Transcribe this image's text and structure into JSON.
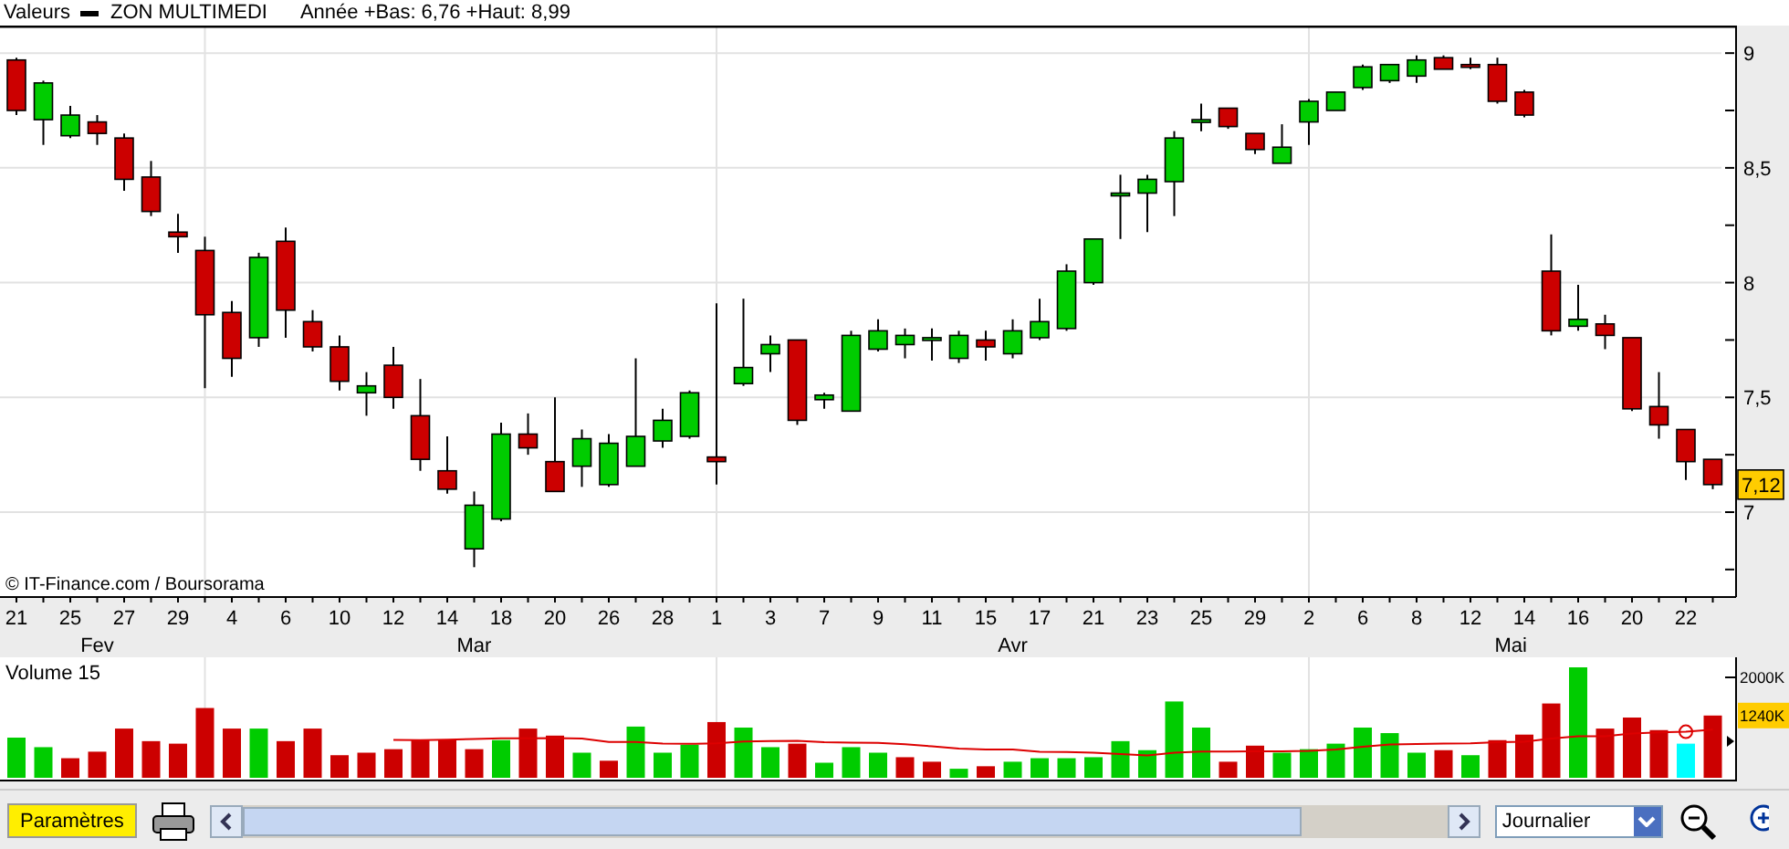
{
  "header": {
    "label": "Valeurs",
    "instrument": "ZON MULTIMEDI",
    "summary": "Année +Bas: 6,76 +Haut: 8,99"
  },
  "price_chart": {
    "source": "© IT-Finance.com / Boursorama",
    "last_price": "7,12",
    "chart_data": {
      "type": "candlestick",
      "grid": true,
      "ylim": [
        6.63,
        9.12
      ],
      "yticks": [
        {
          "value": 9,
          "label": "9"
        },
        {
          "value": 8.5,
          "label": "8,5"
        },
        {
          "value": 8,
          "label": "8"
        },
        {
          "value": 7.5,
          "label": "7,5"
        },
        {
          "value": 7,
          "label": "7"
        }
      ],
      "categories": [
        "21",
        null,
        "25",
        null,
        "27",
        null,
        "29",
        null,
        "4",
        null,
        "6",
        null,
        "10",
        null,
        "12",
        null,
        "14",
        null,
        "18",
        null,
        "20",
        null,
        "26",
        null,
        "28",
        null,
        "1",
        null,
        "3",
        null,
        "7",
        null,
        "9",
        null,
        "11",
        null,
        "15",
        null,
        "17",
        null,
        "21",
        null,
        "23",
        null,
        "25",
        null,
        "29",
        null,
        "2",
        null,
        "6",
        null,
        "8",
        null,
        "12",
        null,
        "14",
        null,
        "16",
        null,
        "20",
        null,
        "22",
        null
      ],
      "ohlc": [
        [
          8.97,
          8.98,
          8.73,
          8.75
        ],
        [
          8.71,
          8.88,
          8.6,
          8.87
        ],
        [
          8.64,
          8.77,
          8.63,
          8.73
        ],
        [
          8.7,
          8.73,
          8.6,
          8.65
        ],
        [
          8.63,
          8.65,
          8.4,
          8.45
        ],
        [
          8.46,
          8.53,
          8.29,
          8.31
        ],
        [
          8.22,
          8.3,
          8.13,
          8.2
        ],
        [
          8.14,
          8.2,
          7.54,
          7.86
        ],
        [
          7.87,
          7.92,
          7.59,
          7.67
        ],
        [
          7.76,
          8.13,
          7.72,
          8.11
        ],
        [
          8.18,
          8.24,
          7.76,
          7.88
        ],
        [
          7.83,
          7.88,
          7.7,
          7.72
        ],
        [
          7.72,
          7.77,
          7.53,
          7.57
        ],
        [
          7.52,
          7.61,
          7.42,
          7.55
        ],
        [
          7.64,
          7.72,
          7.45,
          7.5
        ],
        [
          7.42,
          7.58,
          7.18,
          7.23
        ],
        [
          7.18,
          7.33,
          7.08,
          7.1
        ],
        [
          6.84,
          7.09,
          6.76,
          7.03
        ],
        [
          6.97,
          7.39,
          6.96,
          7.34
        ],
        [
          7.34,
          7.43,
          7.25,
          7.28
        ],
        [
          7.22,
          7.5,
          7.09,
          7.09
        ],
        [
          7.2,
          7.36,
          7.11,
          7.32
        ],
        [
          7.12,
          7.34,
          7.11,
          7.3
        ],
        [
          7.2,
          7.67,
          7.2,
          7.33
        ],
        [
          7.31,
          7.45,
          7.28,
          7.4
        ],
        [
          7.33,
          7.53,
          7.32,
          7.52
        ],
        [
          7.24,
          7.91,
          7.12,
          7.22
        ],
        [
          7.56,
          7.93,
          7.55,
          7.63
        ],
        [
          7.69,
          7.77,
          7.61,
          7.73
        ],
        [
          7.75,
          7.75,
          7.38,
          7.4
        ],
        [
          7.49,
          7.52,
          7.45,
          7.51
        ],
        [
          7.44,
          7.79,
          7.44,
          7.77
        ],
        [
          7.71,
          7.84,
          7.7,
          7.79
        ],
        [
          7.73,
          7.8,
          7.67,
          7.77
        ],
        [
          7.75,
          7.8,
          7.66,
          7.76
        ],
        [
          7.67,
          7.79,
          7.65,
          7.77
        ],
        [
          7.75,
          7.79,
          7.66,
          7.72
        ],
        [
          7.69,
          7.84,
          7.67,
          7.79
        ],
        [
          7.76,
          7.93,
          7.75,
          7.83
        ],
        [
          7.8,
          8.08,
          7.79,
          8.05
        ],
        [
          8.0,
          8.19,
          7.99,
          8.19
        ],
        [
          8.38,
          8.47,
          8.19,
          8.39
        ],
        [
          8.39,
          8.47,
          8.22,
          8.45
        ],
        [
          8.44,
          8.66,
          8.29,
          8.63
        ],
        [
          8.7,
          8.78,
          8.66,
          8.71
        ],
        [
          8.76,
          8.76,
          8.67,
          8.68
        ],
        [
          8.65,
          8.65,
          8.56,
          8.58
        ],
        [
          8.52,
          8.69,
          8.52,
          8.59
        ],
        [
          8.7,
          8.8,
          8.6,
          8.79
        ],
        [
          8.75,
          8.83,
          8.75,
          8.83
        ],
        [
          8.85,
          8.95,
          8.84,
          8.94
        ],
        [
          8.88,
          8.95,
          8.87,
          8.95
        ],
        [
          8.9,
          8.99,
          8.87,
          8.97
        ],
        [
          8.98,
          8.99,
          8.93,
          8.93
        ],
        [
          8.95,
          8.98,
          8.93,
          8.94
        ],
        [
          8.95,
          8.98,
          8.78,
          8.79
        ],
        [
          8.83,
          8.84,
          8.72,
          8.73
        ],
        [
          8.05,
          8.21,
          7.77,
          7.79
        ],
        [
          7.81,
          7.99,
          7.79,
          7.84
        ],
        [
          7.82,
          7.86,
          7.71,
          7.77
        ],
        [
          7.76,
          7.76,
          7.44,
          7.45
        ],
        [
          7.46,
          7.61,
          7.32,
          7.38
        ],
        [
          7.36,
          7.36,
          7.14,
          7.22
        ],
        [
          7.23,
          7.23,
          7.1,
          7.12
        ]
      ]
    }
  },
  "date_axis": {
    "months": [
      "Fev",
      "Mar",
      "Avr",
      "Mai"
    ]
  },
  "volume_chart": {
    "title": "Volume 15",
    "axis_label": "2000K",
    "last_volume": "1240K"
  },
  "toolbar": {
    "settings_button": "Paramètres",
    "period": "Journalier"
  }
}
